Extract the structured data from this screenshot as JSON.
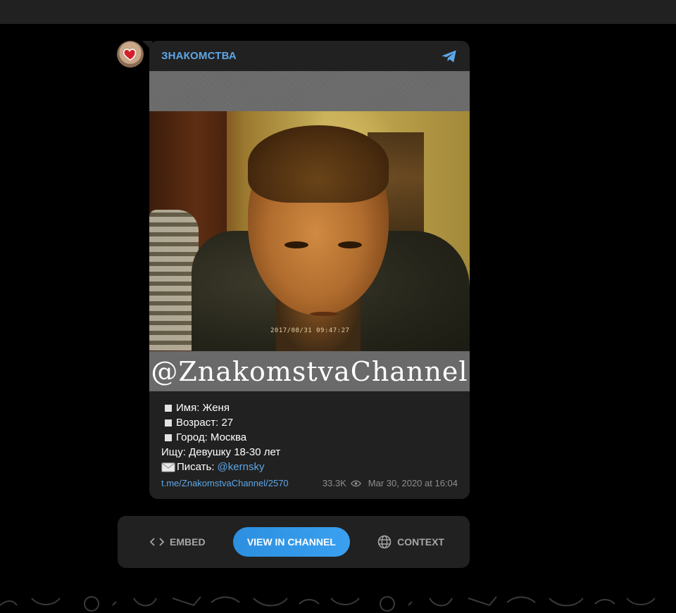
{
  "channel": {
    "name": "ЗНАКОМСТВА",
    "avatar_icon": "heart-icon",
    "app_icon": "telegram-icon"
  },
  "photo": {
    "timestamp": "2017/08/31  09:47:27",
    "watermark": "@ZnakomstvaChannel"
  },
  "post": {
    "lines": [
      {
        "text": "Имя: Женя",
        "bullet": true
      },
      {
        "text": "Возраст: 27",
        "bullet": true
      },
      {
        "text": "Город: Москва",
        "bullet": true
      },
      {
        "text": "Ищу: Девушку 18-30 лет",
        "bullet": false
      }
    ],
    "contact_label": "Писать:",
    "contact_mention": "@kernsky",
    "link": "t.me/ZnakomstvaChannel/2570",
    "views": "33.3K",
    "date": "Mar 30, 2020 at 16:04"
  },
  "actions": {
    "embed": "EMBED",
    "view": "VIEW IN CHANNEL",
    "context": "CONTEXT"
  },
  "colors": {
    "accent": "#5ea6e6",
    "button": "#2c8fe0",
    "card": "#212121"
  }
}
